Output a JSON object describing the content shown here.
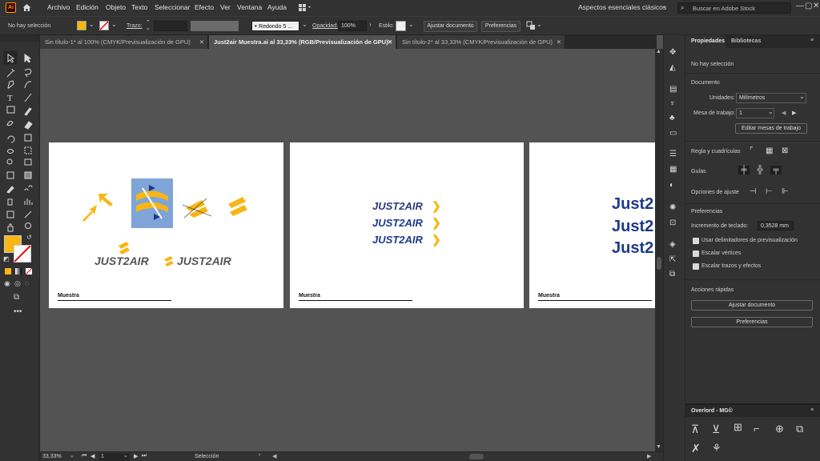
{
  "app": {
    "logo": "Ai",
    "brand_color": "#FF9A00"
  },
  "menu": [
    "Archivo",
    "Edición",
    "Objeto",
    "Texto",
    "Seleccionar",
    "Efecto",
    "Ver",
    "Ventana",
    "Ayuda"
  ],
  "workspace": {
    "name": "Aspectos esenciales clásicos"
  },
  "search": {
    "placeholder": "Buscar en Adobe Stock"
  },
  "control_bar": {
    "selection": "No hay selección",
    "fill_color": "#F7B614",
    "stroke_label": "Trazo:",
    "brush_value": "Redondo 5 ...",
    "opacity_label": "Opacidad:",
    "opacity_value": "100%",
    "style_label": "Estilo:",
    "fit_document": "Ajustar documento",
    "preferences": "Preferencias"
  },
  "tabs": [
    {
      "label": "Sin título-1* al 100% (CMYK/Previsualización de GPU)",
      "active": false
    },
    {
      "label": "Just2air Muestra.ai al 33,33% (RGB/Previsualización de GPU)",
      "active": true
    },
    {
      "label": "Sin título-2* al 33,33% (CMYK/Previsualización de GPU)",
      "active": false
    }
  ],
  "artboards": [
    {
      "caption": "Muestra",
      "logo_text": "JUST2AIR"
    },
    {
      "caption": "Muestra",
      "logo_lines": [
        "JUST2AIR",
        "JUST2AIR",
        "JUST2AIR"
      ]
    },
    {
      "caption": "Muestra",
      "logo_lines": [
        "Just2",
        "Just2",
        "Just2"
      ]
    }
  ],
  "status": {
    "zoom": "33,33%",
    "artboard_index": "1",
    "tool": "Selección"
  },
  "panel": {
    "tabs": [
      "Propiedades",
      "Bibliotecas"
    ],
    "selection": "No hay selección",
    "document_heading": "Documento",
    "units_label": "Unidades:",
    "units_value": "Milímetros",
    "artboard_label": "Mesa de trabajo:",
    "artboard_value": "1",
    "edit_artboards": "Editar mesas de trabajo",
    "rulers_label": "Regla y cuadrículas",
    "guides_label": "Guías",
    "snap_label": "Opciones de ajuste",
    "prefs_heading": "Preferencias",
    "keyboard_increment_label": "Incremento de teclado:",
    "keyboard_increment_value": "0,3528 mm",
    "checkboxes": [
      "Usar delimitadores de previsualización",
      "Escalar vértices",
      "Escalar trazos y efectos"
    ],
    "quick_actions_heading": "Acciones rápidas",
    "fit_document": "Ajustar documento",
    "preferences": "Preferencias"
  },
  "bottom_panel": {
    "title": "Overlord - MG©"
  },
  "colors": {
    "brand_yellow": "#F7B614",
    "brand_navy": "#1E3A8A",
    "logo_gray": "#555555"
  }
}
